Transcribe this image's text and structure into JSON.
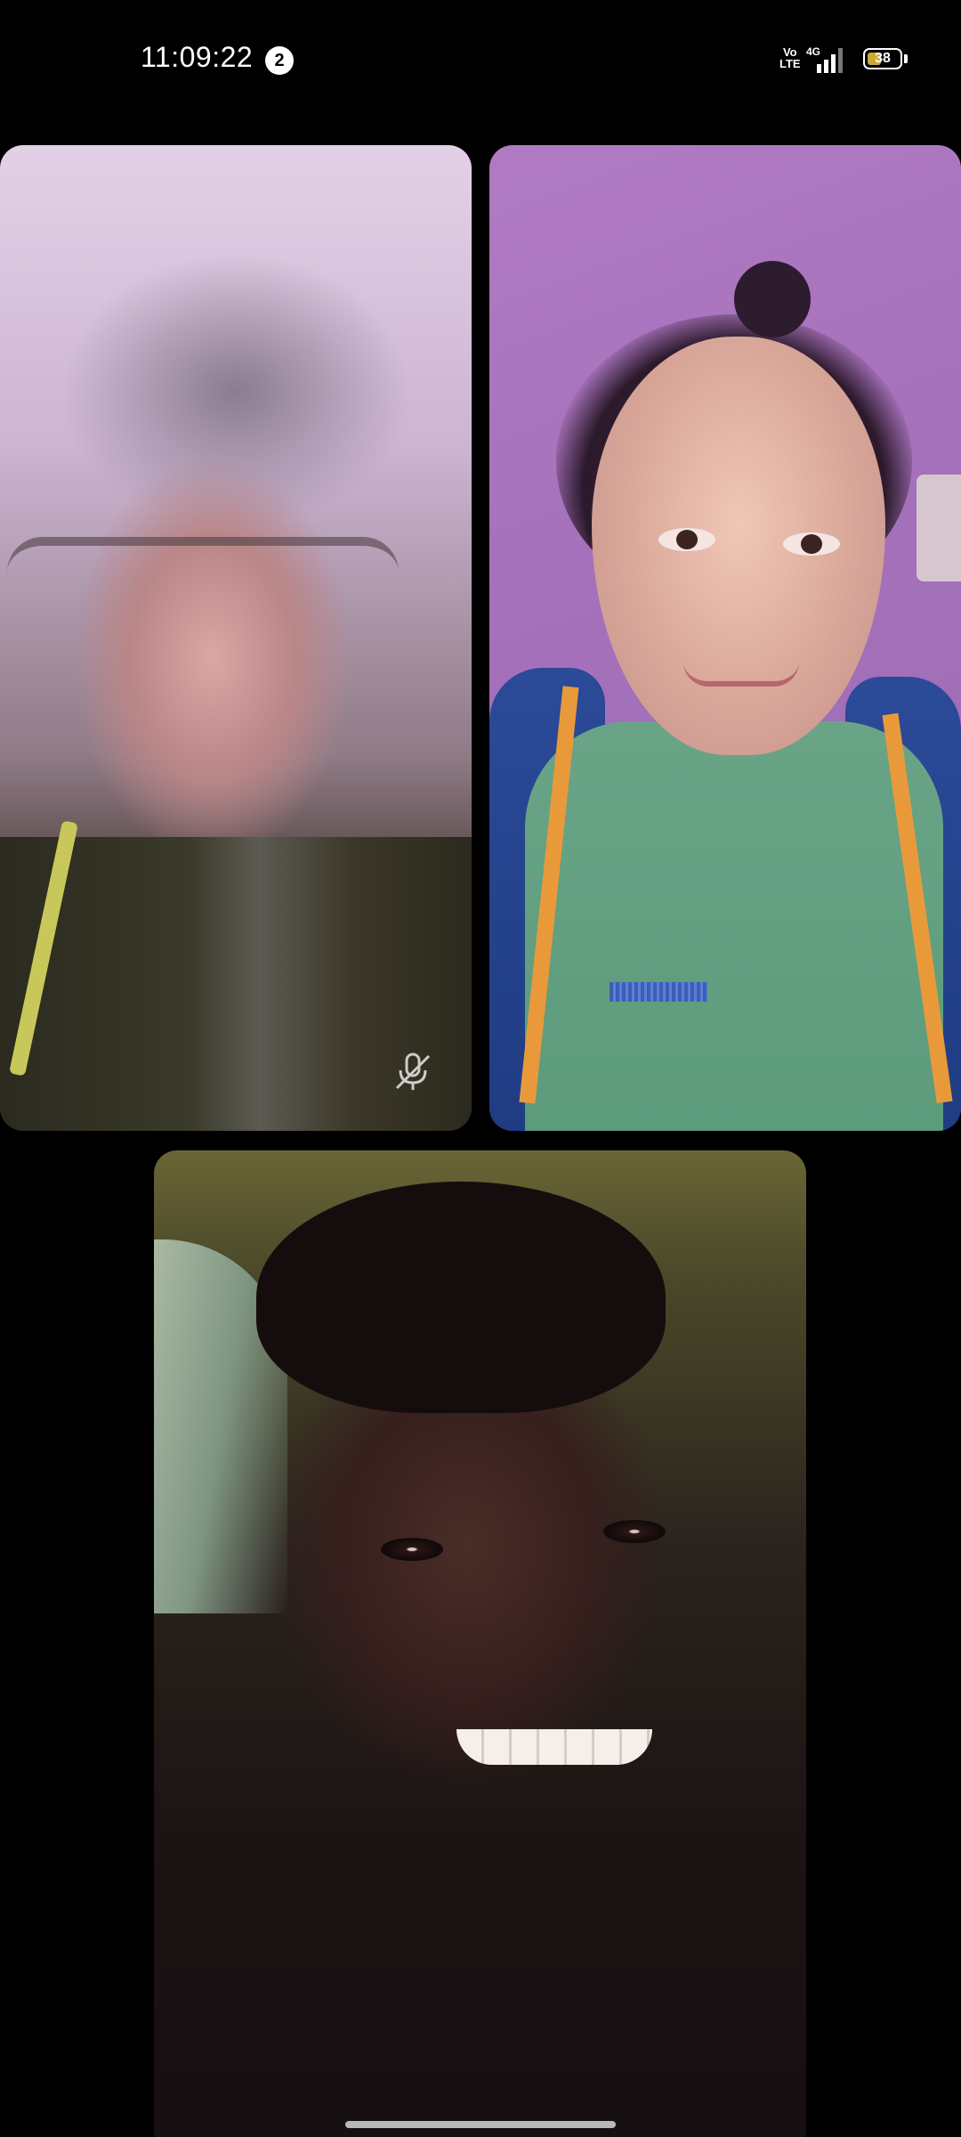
{
  "status_bar": {
    "time": "11:09:22",
    "notification_count": "2",
    "volte_line1": "Vo",
    "volte_line2": "LTE",
    "network": "4G",
    "battery_level": "38"
  },
  "call": {
    "participants": [
      {
        "muted": true
      },
      {
        "muted": false
      },
      {
        "muted": false
      }
    ]
  },
  "colors": {
    "background": "#000000",
    "battery_fill": "#c9a93a"
  },
  "icons": [
    "volte-icon",
    "signal-icon",
    "battery-icon",
    "mic-off-icon"
  ]
}
